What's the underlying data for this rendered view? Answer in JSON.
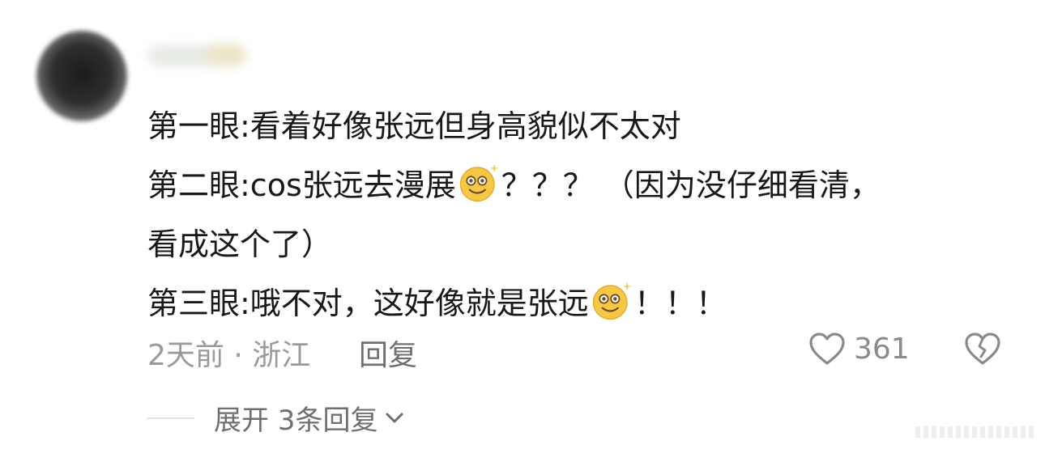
{
  "comment": {
    "lines": [
      "第一眼:看着好像张远但身高貌似不太对",
      "第二眼:cos张远去漫展",
      "？？？ （因为没仔细看清，",
      "看成这个了）",
      "第三眼:哦不对，这好像就是张远",
      "！！！"
    ]
  },
  "meta": {
    "time_location": "2天前 · 浙江",
    "reply_label": "回复",
    "like_count": "361"
  },
  "expand": {
    "label": "展开 3条回复"
  },
  "icons": {
    "emoji": "dizzy-smile-emoji",
    "like": "heart-icon",
    "dislike": "broken-heart-icon",
    "chevron": "chevron-down-icon"
  },
  "colors": {
    "text": "#181818",
    "meta": "#9a9a9a",
    "emoji": "#f6c744"
  }
}
